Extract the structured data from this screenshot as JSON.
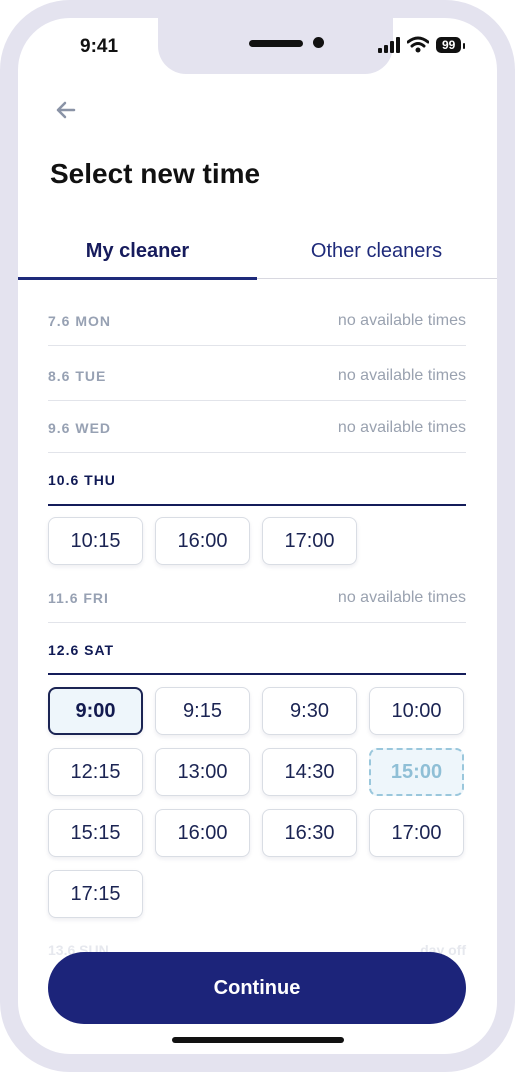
{
  "status": {
    "time": "9:41",
    "battery": "99"
  },
  "header": {
    "title": "Select new time"
  },
  "tabs": [
    {
      "label": "My cleaner"
    },
    {
      "label": "Other cleaners"
    }
  ],
  "days": [
    {
      "label": "7.6 MON",
      "note": "no available times"
    },
    {
      "label": "8.6 TUE",
      "note": "no available times"
    },
    {
      "label": "9.6 WED",
      "note": "no available times"
    },
    {
      "label": "10.6 THU",
      "note": "",
      "slots": [
        "10:15",
        "16:00",
        "17:00"
      ]
    },
    {
      "label": "11.6 FRI",
      "note": "no available times"
    },
    {
      "label": "12.6 SAT",
      "note": "",
      "slots": [
        "9:00",
        "9:15",
        "9:30",
        "10:00",
        "12:15",
        "13:00",
        "14:30",
        "15:00",
        "15:15",
        "16:00",
        "16:30",
        "17:00",
        "17:15"
      ]
    },
    {
      "label": "13.6 SUN",
      "note": "day off"
    }
  ],
  "selected_slot": "12.6 SAT 9:00",
  "highlighted_slot": "12.6 SAT 15:00",
  "footer": {
    "continue_label": "Continue"
  },
  "colors": {
    "primary": "#1c247a",
    "selected_bg": "#eef6fb",
    "muted": "#97a1b3"
  },
  "icons": {
    "back": "arrow-left-icon",
    "signal": "signal-bars-icon",
    "wifi": "wifi-icon",
    "battery": "battery-icon"
  }
}
